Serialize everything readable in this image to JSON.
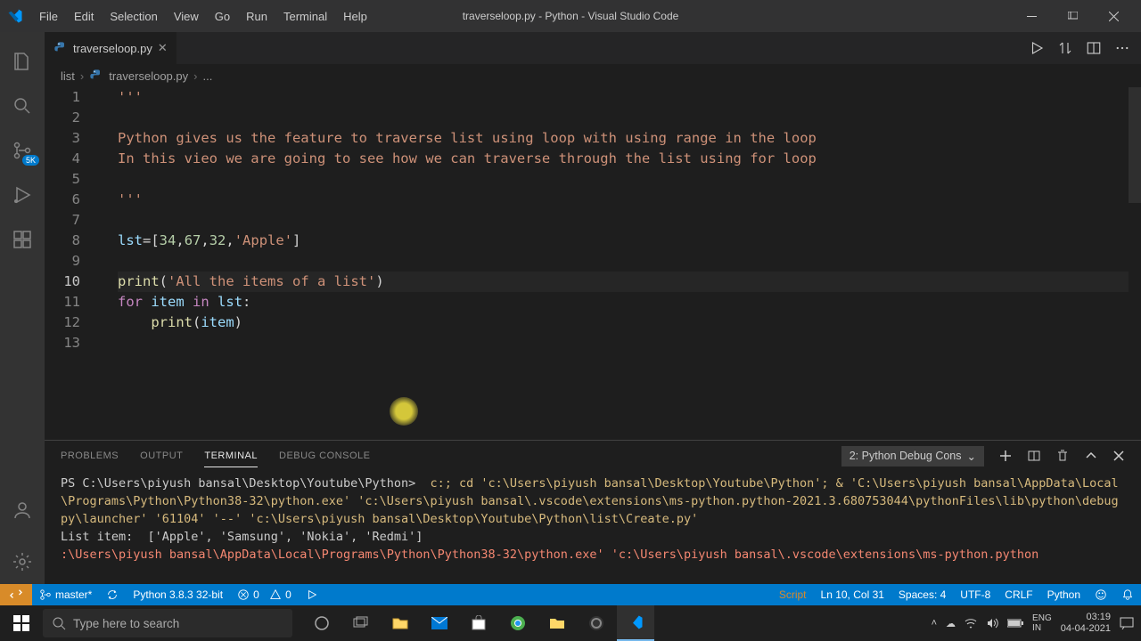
{
  "window": {
    "title": "traverseloop.py - Python - Visual Studio Code"
  },
  "menubar": [
    "File",
    "Edit",
    "Selection",
    "View",
    "Go",
    "Run",
    "Terminal",
    "Help"
  ],
  "activitybar": {
    "scm_badge": "5K"
  },
  "tab": {
    "filename": "traverseloop.py"
  },
  "breadcrumb": {
    "folder": "list",
    "file": "traverseloop.py",
    "ellipsis": "..."
  },
  "code": {
    "line1": "'''",
    "line2": "",
    "line3_a": "Python gives us the feature to traverse list using loop with using range in the loop",
    "line4_a": "In this vieo we are going to see how we can traverse through the list using for loop",
    "line5": "",
    "line6": "'''",
    "line7": "",
    "line8_a": "lst",
    "line8_b": "=[",
    "line8_n1": "34",
    "line8_c1": ",",
    "line8_n2": "67",
    "line8_c2": ",",
    "line8_n3": "32",
    "line8_c3": ",",
    "line8_s1": "'Apple'",
    "line8_d": "]",
    "line9": "",
    "line10_fn": "print",
    "line10_p1": "(",
    "line10_s": "'All the items of a list'",
    "line10_p2": ")",
    "line11_kw1": "for",
    "line11_sp1": " ",
    "line11_v1": "item",
    "line11_sp2": " ",
    "line11_kw2": "in",
    "line11_sp3": " ",
    "line11_v2": "lst",
    "line11_c": ":",
    "line12_ind": "    ",
    "line12_fn": "print",
    "line12_p1": "(",
    "line12_v": "item",
    "line12_p2": ")",
    "line_numbers": [
      "1",
      "2",
      "3",
      "4",
      "5",
      "6",
      "7",
      "8",
      "9",
      "10",
      "11",
      "12",
      "13"
    ]
  },
  "panel": {
    "tabs": [
      "PROBLEMS",
      "OUTPUT",
      "TERMINAL",
      "DEBUG CONSOLE"
    ],
    "active_tab": "TERMINAL",
    "terminal_selector": "2: Python Debug Cons",
    "terminal_lines": {
      "l1_ps": "PS C:\\Users\\piyush bansal\\Desktop\\Youtube\\Python> ",
      "l1_cmd": " c:; cd 'c:\\Users\\piyush bansal\\Desktop\\Youtube\\Python'; & 'C:\\Users\\piyush bansal\\AppData\\Local\\Programs\\Python\\Python38-32\\python.exe' 'c:\\Users\\piyush bansal\\.vscode\\extensions\\ms-python.python-2021.3.680753044\\pythonFiles\\lib\\python\\debugpy\\launcher' '61104' '--' 'c:\\Users\\piyush bansal\\Desktop\\Youtube\\Python\\list\\Create.py'",
      "l2": "List item:  ['Apple', 'Samsung', 'Nokia', 'Redmi']",
      "l3": ":\\Users\\piyush bansal\\AppData\\Local\\Programs\\Python\\Python38-32\\python.exe' 'c:\\Users\\piyush bansal\\.vscode\\extensions\\ms-python.python"
    }
  },
  "statusbar": {
    "branch": "master*",
    "python": "Python 3.8.3 32-bit",
    "errors": "0",
    "warnings": "0",
    "script": "Script",
    "lncol": "Ln 10, Col 31",
    "spaces": "Spaces: 4",
    "encoding": "UTF-8",
    "eol": "CRLF",
    "lang": "Python"
  },
  "taskbar": {
    "search_placeholder": "Type here to search",
    "time": "03:19",
    "date": "04-04-2021"
  }
}
